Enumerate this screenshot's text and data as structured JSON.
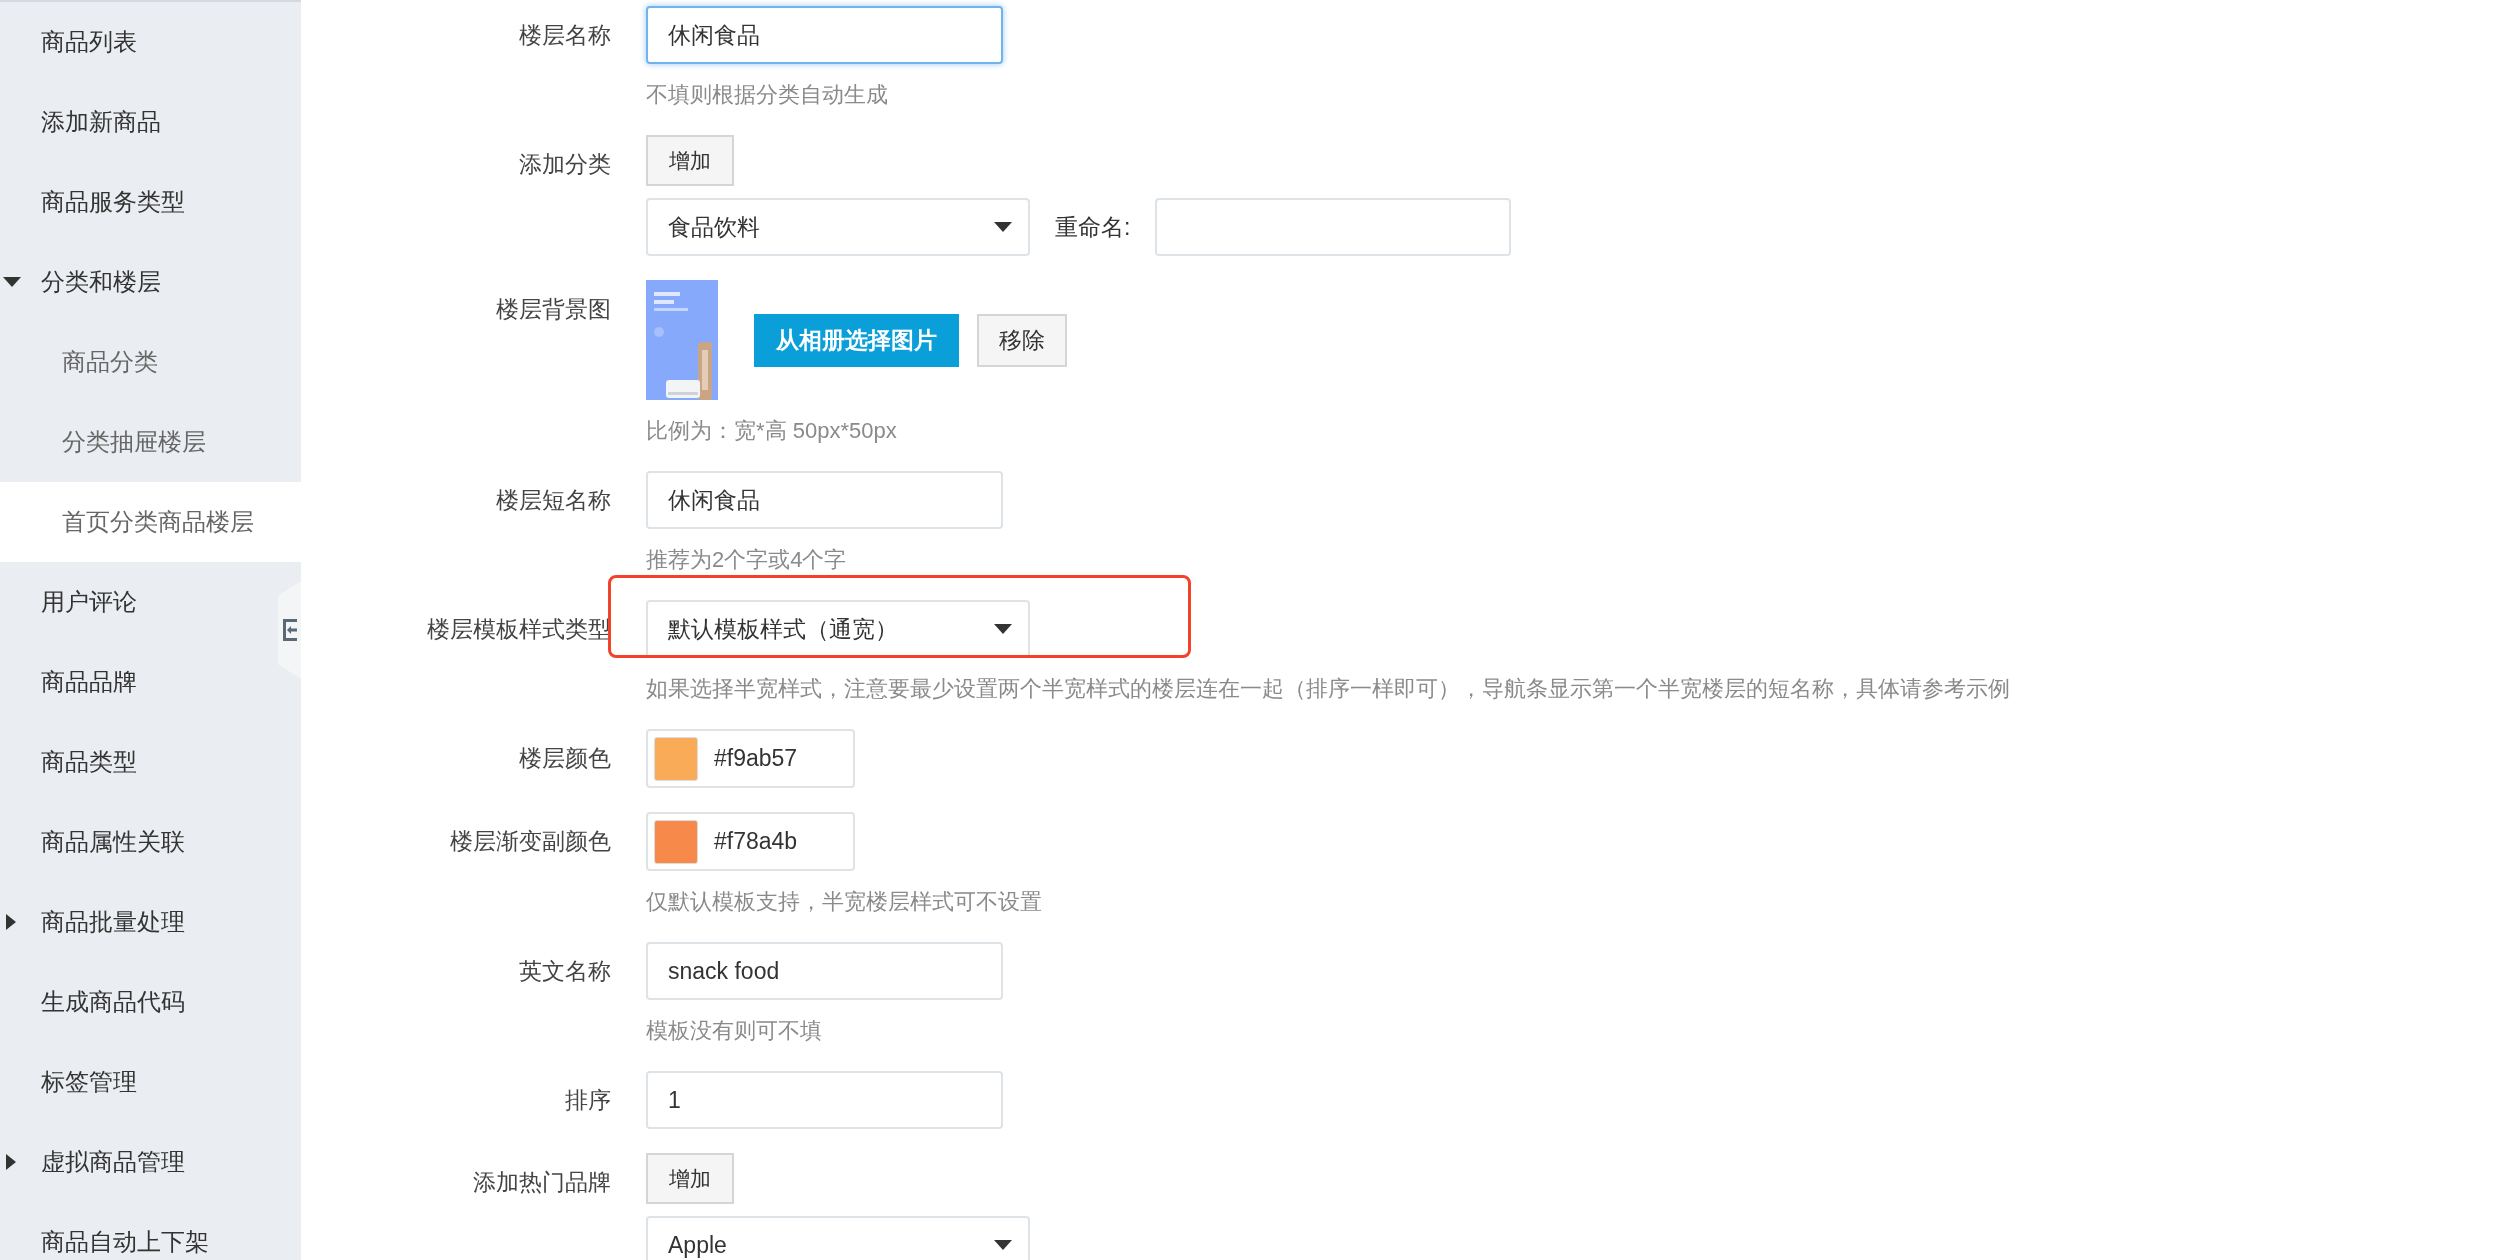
{
  "sidebar": {
    "items": [
      {
        "label": "商品列表",
        "selected": false
      },
      {
        "label": "添加新商品",
        "selected": false
      },
      {
        "label": "商品服务类型",
        "selected": false
      },
      {
        "label": "分类和楼层",
        "selected": false,
        "expanded": true,
        "children": [
          {
            "label": "商品分类",
            "selected": false
          },
          {
            "label": "分类抽屉楼层",
            "selected": false
          },
          {
            "label": "首页分类商品楼层",
            "selected": true
          }
        ]
      },
      {
        "label": "用户评论",
        "selected": false
      },
      {
        "label": "商品品牌",
        "selected": false
      },
      {
        "label": "商品类型",
        "selected": false
      },
      {
        "label": "商品属性关联",
        "selected": false
      },
      {
        "label": "商品批量处理",
        "selected": false,
        "expanded": false
      },
      {
        "label": "生成商品代码",
        "selected": false
      },
      {
        "label": "标签管理",
        "selected": false
      },
      {
        "label": "虚拟商品管理",
        "selected": false,
        "expanded": false
      },
      {
        "label": "商品自动上下架",
        "selected": false
      }
    ]
  },
  "form": {
    "fields": [
      {
        "label": "楼层名称",
        "controls": [
          {
            "kind": "input",
            "value": "休闲食品",
            "focused": true
          }
        ],
        "help": "不填则根据分类自动生成"
      },
      {
        "label": "添加分类",
        "controls": [
          {
            "kind": "button",
            "label": "增加"
          },
          {
            "kind": "select",
            "value": "食品饮料",
            "highlighted": false,
            "rename_label": "重命名:"
          }
        ]
      },
      {
        "label": "楼层背景图",
        "controls": [
          {
            "kind": "image_picker",
            "button": "从相册选择图片",
            "remove": "移除"
          }
        ],
        "help": "比例为：宽*高 50px*50px"
      },
      {
        "label": "楼层短名称",
        "controls": [
          {
            "kind": "input",
            "value": "休闲食品",
            "focused": false
          }
        ],
        "help": "推荐为2个字或4个字"
      },
      {
        "label": "楼层模板样式类型",
        "controls": [
          {
            "kind": "select",
            "value": "默认模板样式（通宽）",
            "highlighted": true
          }
        ],
        "help": "如果选择半宽样式，注意要最少设置两个半宽样式的楼层连在一起（排序一样即可），导航条显示第一个半宽楼层的短名称，具体请参考示例"
      },
      {
        "label": "楼层颜色",
        "controls": [
          {
            "kind": "color",
            "value": "#f9ab57",
            "color": "#f9ab57"
          }
        ]
      },
      {
        "label": "楼层渐变副颜色",
        "controls": [
          {
            "kind": "color",
            "value": "#f78a4b",
            "color": "#f78a4b"
          }
        ],
        "help": "仅默认模板支持，半宽楼层样式可不设置"
      },
      {
        "label": "英文名称",
        "controls": [
          {
            "kind": "input",
            "value": "snack food",
            "focused": false
          }
        ],
        "help": "模板没有则可不填"
      },
      {
        "label": "排序",
        "controls": [
          {
            "kind": "input",
            "value": "1",
            "focused": false
          }
        ]
      },
      {
        "label": "添加热门品牌",
        "controls": [
          {
            "kind": "button",
            "label": "增加"
          },
          {
            "kind": "select",
            "value": "Apple",
            "highlighted": false
          }
        ]
      }
    ]
  }
}
